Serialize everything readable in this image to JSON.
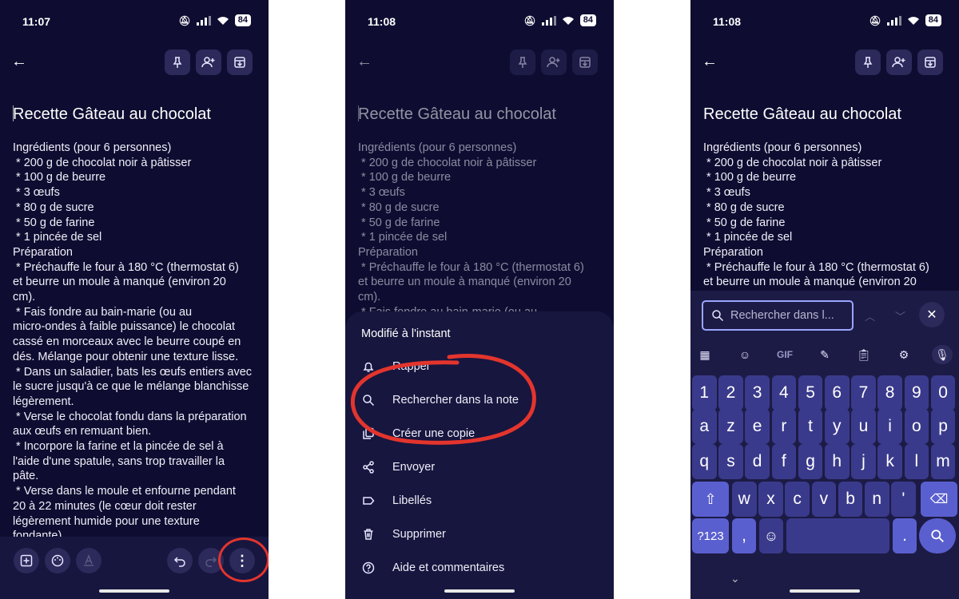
{
  "panels": [
    {
      "time": "11:07",
      "battery": "84"
    },
    {
      "time": "11:08",
      "battery": "84"
    },
    {
      "time": "11:08",
      "battery": "84"
    }
  ],
  "note": {
    "title_rest": "ecette Gâteau au chocolat",
    "title_first": "R",
    "title_full": "Recette Gâteau au chocolat",
    "body_panel1": "Ingrédients (pour 6 personnes)\n * 200 g de chocolat noir à pâtisser\n * 100 g de beurre\n * 3 œufs\n * 80 g de sucre\n * 50 g de farine\n * 1 pincée de sel\nPréparation\n * Préchauffe le four à 180 °C (thermostat 6)\net beurre un moule à manqué (environ 20\ncm).\n * Fais fondre au bain-marie (ou au\nmicro-ondes à faible puissance) le chocolat\ncassé en morceaux avec le beurre coupé en\ndés. Mélange pour obtenir une texture lisse.\n * Dans un saladier, bats les œufs entiers avec\nle sucre jusqu'à ce que le mélange blanchisse\nlégèrement.\n * Verse le chocolat fondu dans la préparation\naux œufs en remuant bien.\n * Incorpore la farine et la pincée de sel à\nl'aide d'une spatule, sans trop travailler la\npâte.\n * Verse dans le moule et enfourne pendant\n20 à 22 minutes (le cœur doit rester\nlégèrement humide pour une texture\nfondante).",
    "body_panel2": "Ingrédients (pour 6 personnes)\n * 200 g de chocolat noir à pâtisser\n * 100 g de beurre\n * 3 œufs\n * 80 g de sucre\n * 50 g de farine\n * 1 pincée de sel\nPréparation\n * Préchauffe le four à 180 °C (thermostat 6)\net beurre un moule à manqué (environ 20\ncm).\n * Fais fondre au bain-marie (ou au",
    "body_panel3": "Ingrédients (pour 6 personnes)\n * 200 g de chocolat noir à pâtisser\n * 100 g de beurre\n * 3 œufs\n * 80 g de sucre\n * 50 g de farine\n * 1 pincée de sel\nPréparation\n * Préchauffe le four à 180 °C (thermostat 6)\net beurre un moule à manqué (environ 20"
  },
  "menu": {
    "header": "Modifié à l'instant",
    "items": [
      {
        "label": "Rappel",
        "icon": "bell-icon"
      },
      {
        "label": "Rechercher dans la note",
        "icon": "search-icon"
      },
      {
        "label": "Créer une copie",
        "icon": "copy-icon"
      },
      {
        "label": "Envoyer",
        "icon": "share-icon"
      },
      {
        "label": "Libellés",
        "icon": "label-icon"
      },
      {
        "label": "Supprimer",
        "icon": "trash-icon"
      },
      {
        "label": "Aide et commentaires",
        "icon": "help-icon"
      }
    ]
  },
  "search": {
    "placeholder": "Rechercher dans l..."
  },
  "keyboard": {
    "tools": [
      "apps-icon",
      "sticker-icon",
      "GIF",
      "magic-icon",
      "clipboard-icon",
      "gear-icon",
      "mic-icon"
    ],
    "row1": [
      "1",
      "2",
      "3",
      "4",
      "5",
      "6",
      "7",
      "8",
      "9",
      "0"
    ],
    "row2": [
      "a",
      "z",
      "e",
      "r",
      "t",
      "y",
      "u",
      "i",
      "o",
      "p"
    ],
    "row3": [
      "q",
      "s",
      "d",
      "f",
      "g",
      "h",
      "j",
      "k",
      "l",
      "m"
    ],
    "row4": [
      "w",
      "x",
      "c",
      "v",
      "b",
      "n",
      "'"
    ],
    "symbols": "?123",
    "comma": ",",
    "period": "."
  },
  "colors": {
    "background": "#0e0d31",
    "sheet": "#17163f",
    "annotation": "#e3352d",
    "key": "#3a3a8c",
    "key_special": "#5a5fcf"
  }
}
